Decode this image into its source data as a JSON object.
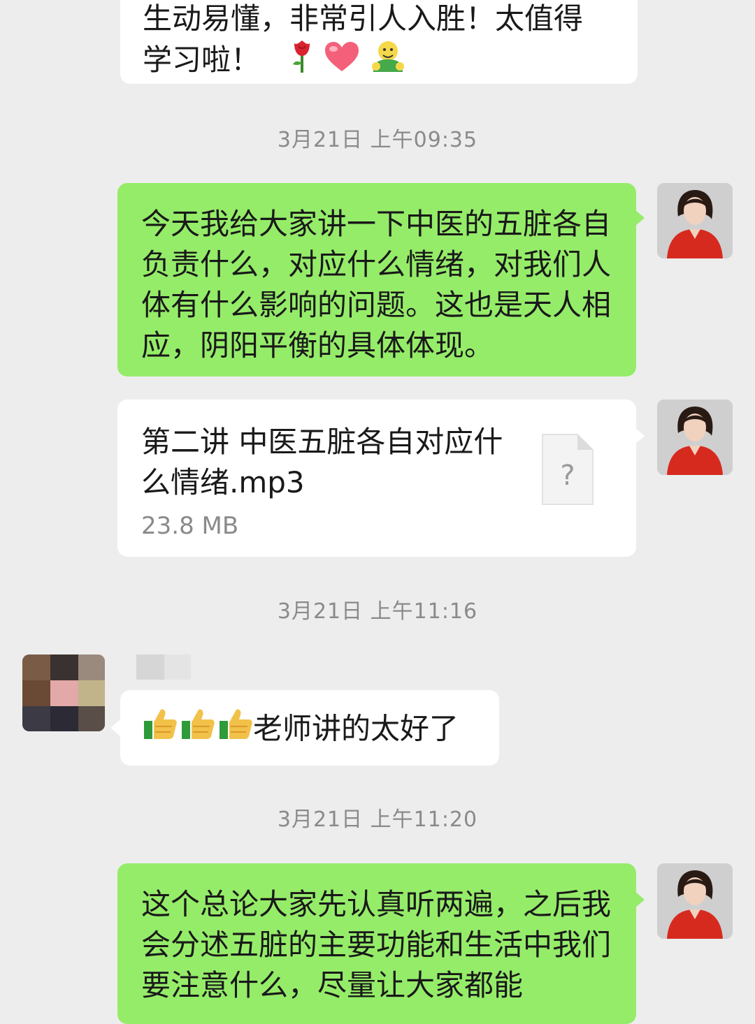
{
  "messages": {
    "m0": {
      "line1": "生动易懂，非常引人入胜！太值得",
      "line2": "学习啦！"
    },
    "ts1": "3月21日 上午09:35",
    "m1": {
      "text": "今天我给大家讲一下中医的五脏各自负责什么，对应什么情绪，对我们人体有什么影响的问题。这也是天人相应，阴阳平衡的具体体现。"
    },
    "m2": {
      "file_name": "第二讲 中医五脏各自对应什么情绪.mp3",
      "file_size": "23.8 MB",
      "file_icon_glyph": "?"
    },
    "ts2": "3月21日 上午11:16",
    "m3": {
      "text": "老师讲的太好了"
    },
    "ts3": "3月21日 上午11:20",
    "m4": {
      "text": "这个总论大家先认真听两遍，之后我会分述五脏的主要功能和生活中我们要注意什么，尽量让大家都能"
    }
  },
  "colors": {
    "background": "#ededed",
    "self_bubble": "#95ec69",
    "other_bubble": "#ffffff",
    "timestamp": "#8a8a8a"
  },
  "icons": [
    "rose-emoji-icon",
    "heart-emoji-icon",
    "hug-emoji-icon",
    "thumbs-up-emoji-icon",
    "unknown-file-icon"
  ]
}
